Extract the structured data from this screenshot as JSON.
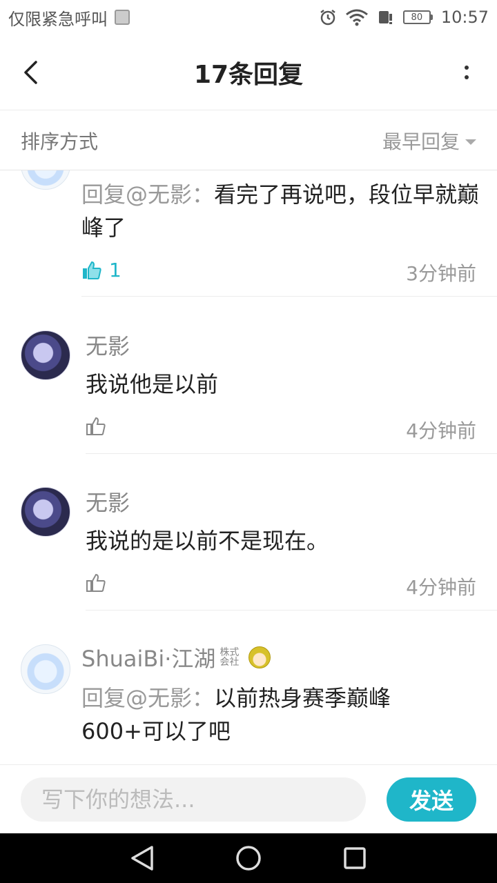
{
  "status_bar": {
    "carrier": "仅限紧急呼叫",
    "battery": "80",
    "time": "10:57"
  },
  "header": {
    "title": "17条回复"
  },
  "sort": {
    "label": "排序方式",
    "selected": "最早回复"
  },
  "comments": [
    {
      "author": "",
      "mention": "回复@无影：",
      "text": "看完了再说吧，段位早就巅峰了",
      "likes": "1",
      "time": "3分钟前"
    },
    {
      "author": "无影",
      "text": "我说他是以前",
      "time": "4分钟前"
    },
    {
      "author": "无影",
      "text": "我说的是以前不是现在。",
      "time": "4分钟前"
    },
    {
      "author": "ShuaiBi·江湖",
      "badge": "株式会社",
      "mention": "回复@无影：",
      "text": "以前热身赛季巅峰600+可以了吧"
    }
  ],
  "input": {
    "placeholder": "写下你的想法..."
  },
  "send": {
    "label": "发送"
  },
  "colors": {
    "accent": "#1fb6c9"
  }
}
